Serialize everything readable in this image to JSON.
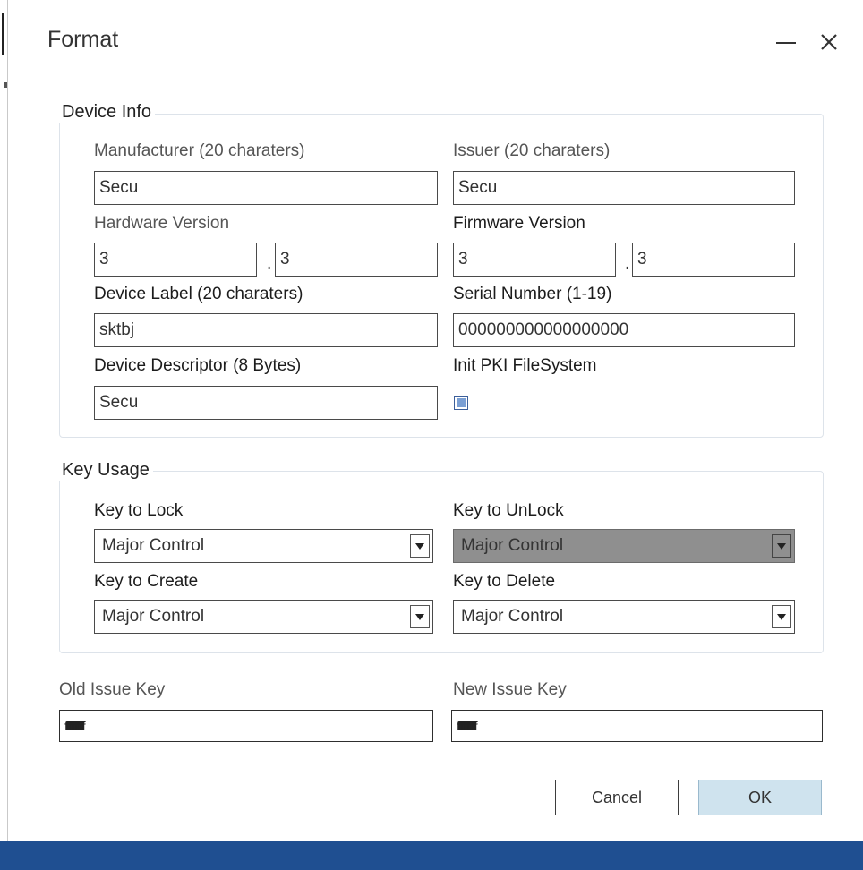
{
  "window": {
    "title": "Format"
  },
  "device_info": {
    "title": "Device Info",
    "manufacturer_label": "Manufacturer (20 charaters)",
    "manufacturer_value": "Secu",
    "issuer_label": "Issuer (20 charaters)",
    "issuer_value": "Secu",
    "hardware_version_label": "Hardware Version",
    "hardware_version_major": "3",
    "hardware_version_minor": "3",
    "firmware_version_label": "Firmware Version",
    "firmware_version_major": "3",
    "firmware_version_minor": "3",
    "version_separator": ".",
    "device_label_label": "Device Label (20 charaters)",
    "device_label_value": "sktbj",
    "serial_number_label": "Serial Number (1-19)",
    "serial_number_value": "000000000000000000",
    "device_descriptor_label": "Device Descriptor (8 Bytes)",
    "device_descriptor_value": "Secu",
    "init_pki_label": "Init PKI FileSystem",
    "init_pki_checked": true
  },
  "key_usage": {
    "title": "Key Usage",
    "lock_label": "Key to Lock",
    "lock_value": "Major Control",
    "unlock_label": "Key to UnLock",
    "unlock_value": "Major Control",
    "unlock_disabled": true,
    "create_label": "Key to Create",
    "create_value": "Major Control",
    "delete_label": "Key to Delete",
    "delete_value": "Major Control"
  },
  "issue_keys": {
    "old_label": "Old Issue Key",
    "old_value": "ffffffffffffffffffffffffffffffff",
    "new_label": "New Issue Key",
    "new_value": "ffffffffffffffffffffffffffffffff"
  },
  "buttons": {
    "cancel": "Cancel",
    "ok": "OK"
  },
  "colors": {
    "bottom_bar": "#1f4f91",
    "ok_button_bg": "#cfe3ee",
    "disabled_combo_bg": "#8f8f8f",
    "checkbox_fill": "#7a9fd4"
  },
  "icons": {
    "minimize": "minimize-icon",
    "close": "close-icon",
    "dropdown": "chevron-down-icon"
  }
}
